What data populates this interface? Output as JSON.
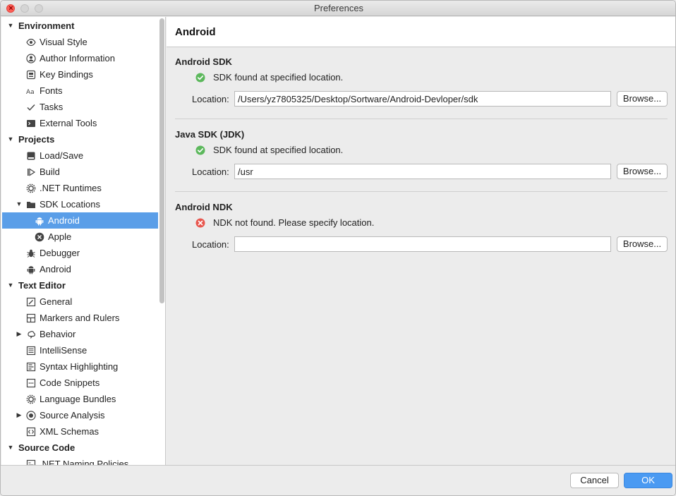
{
  "window": {
    "title": "Preferences"
  },
  "sidebar": {
    "items": [
      {
        "label": "Environment",
        "type": "group",
        "expanded": true,
        "icon": ""
      },
      {
        "label": "Visual Style",
        "type": "item",
        "icon": "eye-icon"
      },
      {
        "label": "Author Information",
        "type": "item",
        "icon": "person-circle-icon"
      },
      {
        "label": "Key Bindings",
        "type": "item",
        "icon": "keyboard-icon"
      },
      {
        "label": "Fonts",
        "type": "item",
        "icon": "font-icon"
      },
      {
        "label": "Tasks",
        "type": "item",
        "icon": "checkmark-icon"
      },
      {
        "label": "External Tools",
        "type": "item",
        "icon": "terminal-icon"
      },
      {
        "label": "Projects",
        "type": "group",
        "expanded": true,
        "icon": ""
      },
      {
        "label": "Load/Save",
        "type": "item",
        "icon": "disk-icon"
      },
      {
        "label": "Build",
        "type": "item",
        "icon": "build-icon"
      },
      {
        "label": ".NET Runtimes",
        "type": "item",
        "icon": "gear-icon"
      },
      {
        "label": "SDK Locations",
        "type": "subgroup",
        "expanded": true,
        "icon": "folder-icon"
      },
      {
        "label": "Android",
        "type": "subitem",
        "icon": "android-icon",
        "selected": true
      },
      {
        "label": "Apple",
        "type": "subitem",
        "icon": "x-circle-icon"
      },
      {
        "label": "Debugger",
        "type": "item",
        "icon": "bug-icon"
      },
      {
        "label": "Android",
        "type": "item",
        "icon": "android-icon"
      },
      {
        "label": "Text Editor",
        "type": "group",
        "expanded": true,
        "icon": ""
      },
      {
        "label": "General",
        "type": "item",
        "icon": "edit-icon"
      },
      {
        "label": "Markers and Rulers",
        "type": "item",
        "icon": "ruler-icon"
      },
      {
        "label": "Behavior",
        "type": "subgroup",
        "expanded": false,
        "icon": "brain-icon"
      },
      {
        "label": "IntelliSense",
        "type": "item",
        "icon": "list-icon"
      },
      {
        "label": "Syntax Highlighting",
        "type": "item",
        "icon": "highlight-icon"
      },
      {
        "label": "Code Snippets",
        "type": "item",
        "icon": "snippet-icon"
      },
      {
        "label": "Language Bundles",
        "type": "item",
        "icon": "gear-icon"
      },
      {
        "label": "Source Analysis",
        "type": "subgroup",
        "expanded": false,
        "icon": "target-icon"
      },
      {
        "label": "XML Schemas",
        "type": "item",
        "icon": "xml-icon"
      },
      {
        "label": "Source Code",
        "type": "group",
        "expanded": true,
        "icon": ""
      },
      {
        "label": ".NET Naming Policies",
        "type": "item",
        "icon": "naming-icon"
      }
    ]
  },
  "main": {
    "title": "Android",
    "sections": [
      {
        "title": "Android SDK",
        "status": "ok",
        "status_icon": "check-circle-icon",
        "status_text": "SDK found at specified location.",
        "location_label": "Location:",
        "location_value": "/Users/yz7805325/Desktop/Sortware/Android-Devloper/sdk",
        "browse_label": "Browse..."
      },
      {
        "title": "Java SDK (JDK)",
        "status": "ok",
        "status_icon": "check-circle-icon",
        "status_text": "SDK found at specified location.",
        "location_label": "Location:",
        "location_value": "/usr",
        "browse_label": "Browse..."
      },
      {
        "title": "Android NDK",
        "status": "error",
        "status_icon": "error-circle-icon",
        "status_text": "NDK not found. Please specify location.",
        "location_label": "Location:",
        "location_value": "",
        "browse_label": "Browse..."
      }
    ]
  },
  "footer": {
    "cancel_label": "Cancel",
    "ok_label": "OK"
  },
  "colors": {
    "selection": "#5a9ee8",
    "ok_button": "#4a9af2",
    "status_ok": "#5cb85c",
    "status_error": "#e8574f"
  }
}
